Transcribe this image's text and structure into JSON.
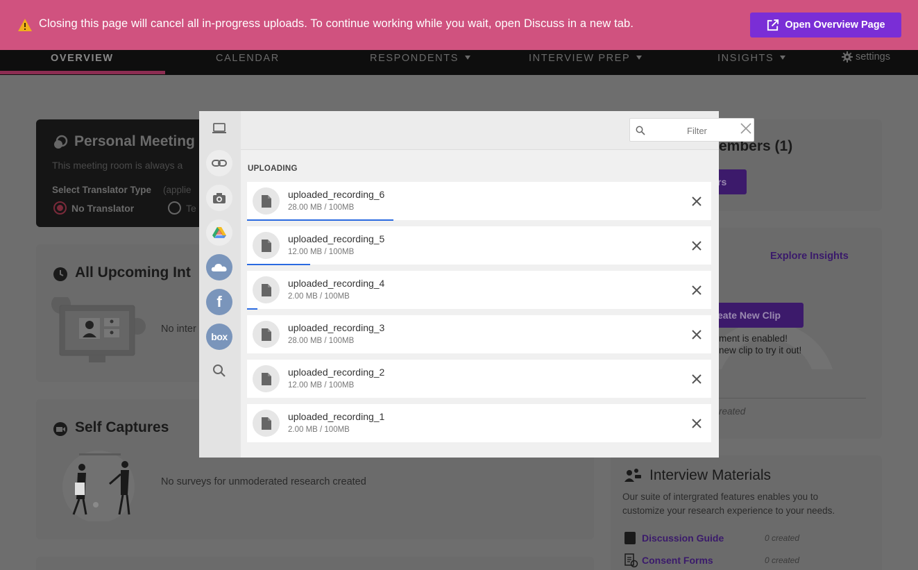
{
  "banner": {
    "message": "Closing this page will cancel all in-progress uploads. To continue working while you wait, open Discuss in a new tab.",
    "button_label": "Open Overview Page"
  },
  "nav": {
    "tabs": [
      "OVERVIEW",
      "CALENDAR",
      "RESPONDENTS",
      "INTERVIEW PREP",
      "INSIGHTS"
    ],
    "settings_label": "settings"
  },
  "background": {
    "meeting_title": "Personal Meeting",
    "meeting_desc": "This meeting room is always a",
    "translator_label": "Select Translator Type",
    "translator_hint": "(applie",
    "no_translator": "No Translator",
    "other_option": "Te",
    "upcoming_title": "All Upcoming Int",
    "upcoming_empty": "No inter",
    "self_captures_title": "Self Captures",
    "self_captures_empty": "No surveys for unmoderated research created",
    "members_title": "embers (1)",
    "members_btn": "rs",
    "explore_insights": "Explore Insights",
    "create_clip": "eate New Clip",
    "clip_line1": "ment is enabled!",
    "clip_line2": "new clip to try it out!",
    "created_text": "reated",
    "materials_title": "Interview Materials",
    "materials_desc1": "Our suite of intergrated features enables you to",
    "materials_desc2": "customize your research experience to your needs.",
    "discussion_guide": "Discussion Guide",
    "consent_forms": "Consent Forms",
    "zero_created": "0 created"
  },
  "modal": {
    "filter_placeholder": "Filter",
    "section_label": "UPLOADING",
    "files": [
      {
        "name": "uploaded_recording_6",
        "size": "28.00 MB / 100MB",
        "progress": 0.28
      },
      {
        "name": "uploaded_recording_5",
        "size": "12.00 MB / 100MB",
        "progress": 0.12
      },
      {
        "name": "uploaded_recording_4",
        "size": "2.00 MB / 100MB",
        "progress": 0.02
      },
      {
        "name": "uploaded_recording_3",
        "size": "28.00 MB / 100MB",
        "progress": 0
      },
      {
        "name": "uploaded_recording_2",
        "size": "12.00 MB / 100MB",
        "progress": 0
      },
      {
        "name": "uploaded_recording_1",
        "size": "2.00 MB / 100MB",
        "progress": 0
      }
    ],
    "sources": [
      "laptop-icon",
      "link-icon",
      "camera-icon",
      "google-drive-icon",
      "onedrive-icon",
      "facebook-icon",
      "box-icon",
      "search-icon"
    ],
    "box_text": "box",
    "facebook_text": "f"
  },
  "colors": {
    "banner": "#d0527f",
    "accent_purple": "#7a2ed6",
    "progress_blue": "#2a6ae0"
  }
}
